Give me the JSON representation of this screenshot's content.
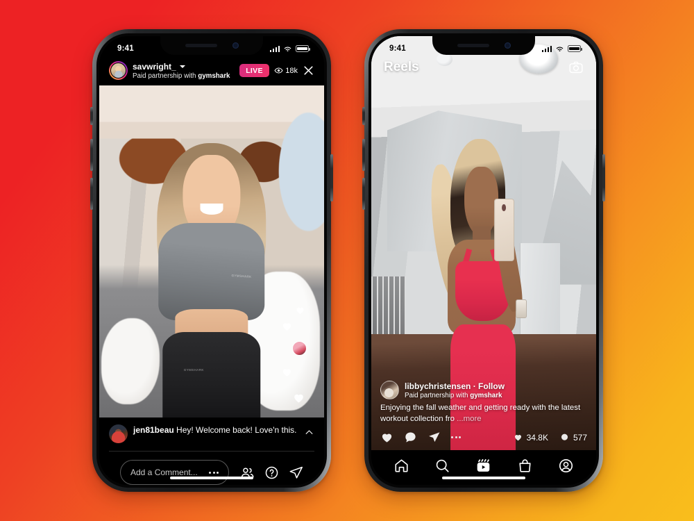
{
  "background": {
    "gradient_from": "#ED2224",
    "gradient_to": "#F9BE1C"
  },
  "live_phone": {
    "status_bar": {
      "time": "9:41",
      "signal_icon": "cellular-bars-icon",
      "wifi_icon": "wifi-icon",
      "battery_icon": "battery-icon"
    },
    "header": {
      "avatar": "savwright-avatar",
      "username": "savwright_",
      "chevron_icon": "chevron-down-icon",
      "partnership": "Paid partnership with ",
      "partnership_brand": "gymshark",
      "live_badge": "LIVE",
      "viewers": "18k",
      "eye_icon": "eye-icon",
      "close_icon": "close-x-icon"
    },
    "video": {
      "brand_overlay_1": "GYMSHARK",
      "brand_overlay_2": "GYMSHARK"
    },
    "comment": {
      "avatar": "jen81beau-avatar",
      "username": "jen81beau",
      "text": " Hey! Welcome back! Love'n this.",
      "collapse_icon": "chevron-up-icon"
    },
    "compose": {
      "placeholder": "Add a Comment...",
      "more_icon": "more-dots-icon",
      "people_icon": "people-icon",
      "help_icon": "question-circle-icon",
      "share_icon": "paper-plane-icon"
    },
    "home_indicator": "home-indicator"
  },
  "reels_phone": {
    "status_bar": {
      "time": "9:41",
      "signal_icon": "cellular-bars-icon",
      "wifi_icon": "wifi-icon",
      "battery_icon": "battery-icon"
    },
    "header": {
      "title": "Reels",
      "camera_icon": "camera-icon"
    },
    "post": {
      "avatar": "libbychristensen-avatar",
      "username": "libbychristensen",
      "separator": " · ",
      "follow_label": "Follow",
      "partnership": "Paid partnership with ",
      "partnership_brand": "gymshark",
      "caption": "Enjoying the fall weather and getting ready with the latest workout collection fro ",
      "caption_more": "...more",
      "like_icon": "heart-icon",
      "comment_icon": "comment-bubble-icon",
      "share_icon": "paper-plane-icon",
      "more_icon": "more-dots-icon",
      "likes_count": "34.8K",
      "comments_count": "577",
      "likes_icon": "heart-filled-icon",
      "comments_icon": "comment-filled-icon"
    },
    "tabbar": {
      "home_icon": "home-icon",
      "search_icon": "search-icon",
      "reels_icon": "reels-icon",
      "shop_icon": "shop-bag-icon",
      "profile_icon": "profile-avatar-icon"
    },
    "home_indicator": "home-indicator"
  }
}
